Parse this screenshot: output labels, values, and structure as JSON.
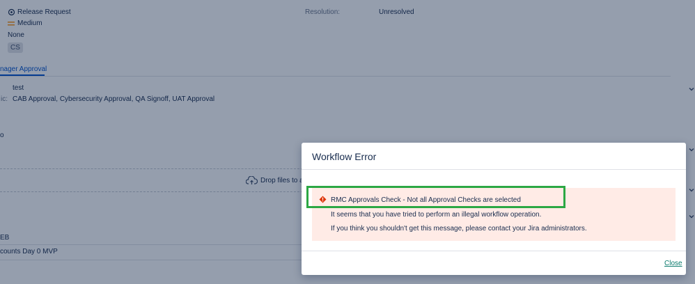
{
  "details": {
    "issue_type": "Release Request",
    "priority": "Medium",
    "none_value": "None",
    "label": "CS",
    "resolution_label": "Resolution:",
    "resolution_value": "Unresolved"
  },
  "tabs": {
    "active": "nager Approval"
  },
  "fields": {
    "test_value": "test",
    "checks_label_fragment": "ic:",
    "checks_value": "CAB Approval, Cybersecurity Approval, QA Signoff, UAT Approval",
    "fragment_o": "o",
    "drop_files": "Drop files to a",
    "fragment_eb": "EB",
    "fragment_counts": "counts Day 0 MVP"
  },
  "modal": {
    "title": "Workflow Error",
    "error_heading": "RMC Approvals Check - Not all Approval Checks are selected",
    "error_line1": "It seems that you have tried to perform an illegal workflow operation.",
    "error_line2": "If you think you shouldn't get this message, please contact your Jira administrators.",
    "close_label": "Close"
  },
  "colors": {
    "overlay": "#5d6a85",
    "error_bg": "#ffebe6",
    "error_icon": "#de350b",
    "highlight": "#2ca844",
    "link": "#0a7a6c"
  }
}
